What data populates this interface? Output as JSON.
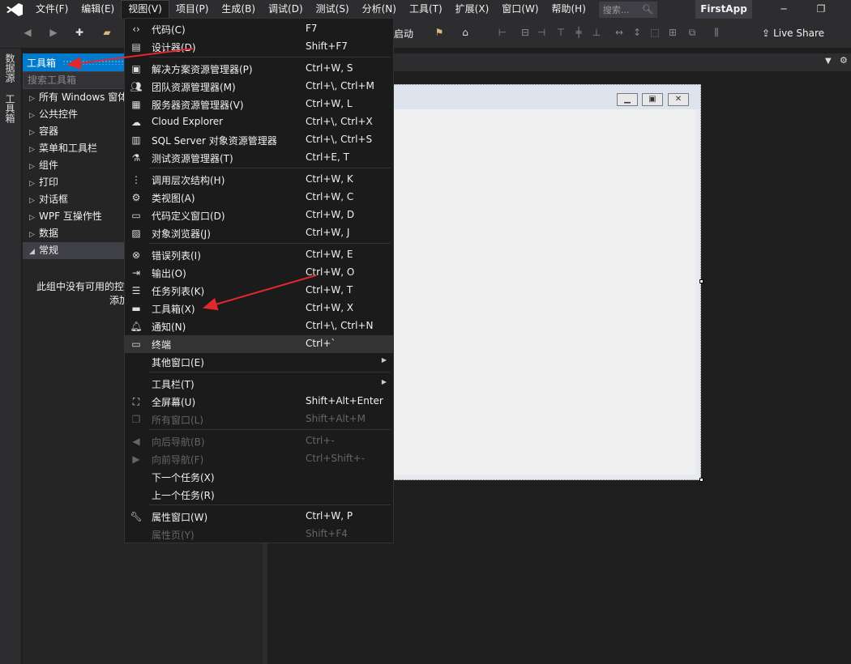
{
  "menubar": {
    "items": [
      "文件(F)",
      "编辑(E)",
      "视图(V)",
      "项目(P)",
      "生成(B)",
      "调试(D)",
      "测试(S)",
      "分析(N)",
      "工具(T)",
      "扩展(X)",
      "窗口(W)",
      "帮助(H)"
    ],
    "active_index": 2,
    "search_placeholder": "搜索...",
    "app_title": "FirstApp"
  },
  "toolbar": {
    "start_label": "启动",
    "live_share_label": "Live Share"
  },
  "side_tabs": [
    "数据源",
    "工具箱"
  ],
  "toolbox": {
    "title": "工具箱",
    "search_placeholder": "搜索工具箱",
    "groups": [
      {
        "label": "所有 Windows 窗体",
        "expanded": false
      },
      {
        "label": "公共控件",
        "expanded": false
      },
      {
        "label": "容器",
        "expanded": false
      },
      {
        "label": "菜单和工具栏",
        "expanded": false
      },
      {
        "label": "组件",
        "expanded": false
      },
      {
        "label": "打印",
        "expanded": false
      },
      {
        "label": "对话框",
        "expanded": false
      },
      {
        "label": "WPF 互操作性",
        "expanded": false
      },
      {
        "label": "数据",
        "expanded": false
      },
      {
        "label": "常规",
        "expanded": true
      }
    ],
    "empty_note_line1": "此组中没有可用的控件。将某项拖至此文本可将其",
    "empty_note_line2": "添加到工具箱。"
  },
  "view_menu": {
    "items": [
      {
        "label": "代码(C)",
        "shortcut": "F7",
        "icon": "code-icon"
      },
      {
        "label": "设计器(D)",
        "shortcut": "Shift+F7",
        "icon": "designer-icon"
      },
      {
        "sep": true
      },
      {
        "label": "解决方案资源管理器(P)",
        "shortcut": "Ctrl+W, S",
        "icon": "solution-explorer-icon"
      },
      {
        "label": "团队资源管理器(M)",
        "shortcut": "Ctrl+\\, Ctrl+M",
        "icon": "team-explorer-icon"
      },
      {
        "label": "服务器资源管理器(V)",
        "shortcut": "Ctrl+W, L",
        "icon": "server-explorer-icon"
      },
      {
        "label": "Cloud Explorer",
        "shortcut": "Ctrl+\\, Ctrl+X",
        "icon": "cloud-icon"
      },
      {
        "label": "SQL Server 对象资源管理器",
        "shortcut": "Ctrl+\\, Ctrl+S",
        "icon": "sql-server-icon"
      },
      {
        "label": "测试资源管理器(T)",
        "shortcut": "Ctrl+E, T",
        "icon": "test-explorer-icon"
      },
      {
        "sep": true
      },
      {
        "label": "调用层次结构(H)",
        "shortcut": "Ctrl+W, K",
        "icon": "call-hierarchy-icon"
      },
      {
        "label": "类视图(A)",
        "shortcut": "Ctrl+W, C",
        "icon": "class-view-icon"
      },
      {
        "label": "代码定义窗口(D)",
        "shortcut": "Ctrl+W, D",
        "icon": "code-definition-icon"
      },
      {
        "label": "对象浏览器(J)",
        "shortcut": "Ctrl+W, J",
        "icon": "object-browser-icon"
      },
      {
        "sep": true
      },
      {
        "label": "错误列表(I)",
        "shortcut": "Ctrl+W, E",
        "icon": "error-list-icon"
      },
      {
        "label": "输出(O)",
        "shortcut": "Ctrl+W, O",
        "icon": "output-icon"
      },
      {
        "label": "任务列表(K)",
        "shortcut": "Ctrl+W, T",
        "icon": "task-list-icon"
      },
      {
        "label": "工具箱(X)",
        "shortcut": "Ctrl+W, X",
        "icon": "toolbox-icon"
      },
      {
        "label": "通知(N)",
        "shortcut": "Ctrl+\\, Ctrl+N",
        "icon": "bell-icon"
      },
      {
        "label": "终端",
        "shortcut": "Ctrl+`",
        "icon": "terminal-icon",
        "hover": true
      },
      {
        "label": "其他窗口(E)",
        "shortcut": "",
        "icon": "",
        "submenu": true
      },
      {
        "sep": true
      },
      {
        "label": "工具栏(T)",
        "shortcut": "",
        "icon": "",
        "submenu": true
      },
      {
        "label": "全屏幕(U)",
        "shortcut": "Shift+Alt+Enter",
        "icon": "fullscreen-icon"
      },
      {
        "label": "所有窗口(L)",
        "shortcut": "Shift+Alt+M",
        "icon": "all-windows-icon",
        "disabled": true
      },
      {
        "sep": true
      },
      {
        "label": "向后导航(B)",
        "shortcut": "Ctrl+-",
        "icon": "navigate-back-icon",
        "disabled": true
      },
      {
        "label": "向前导航(F)",
        "shortcut": "Ctrl+Shift+-",
        "icon": "navigate-forward-icon",
        "disabled": true
      },
      {
        "label": "下一个任务(X)",
        "shortcut": "",
        "icon": ""
      },
      {
        "label": "上一个任务(R)",
        "shortcut": "",
        "icon": ""
      },
      {
        "sep": true
      },
      {
        "label": "属性窗口(W)",
        "shortcut": "Ctrl+W, P",
        "icon": "wrench-icon"
      },
      {
        "label": "属性页(Y)",
        "shortcut": "Shift+F4",
        "icon": "",
        "disabled": true
      }
    ]
  },
  "colors": {
    "accent": "#007acc",
    "annotation_arrow": "#e0282e"
  }
}
